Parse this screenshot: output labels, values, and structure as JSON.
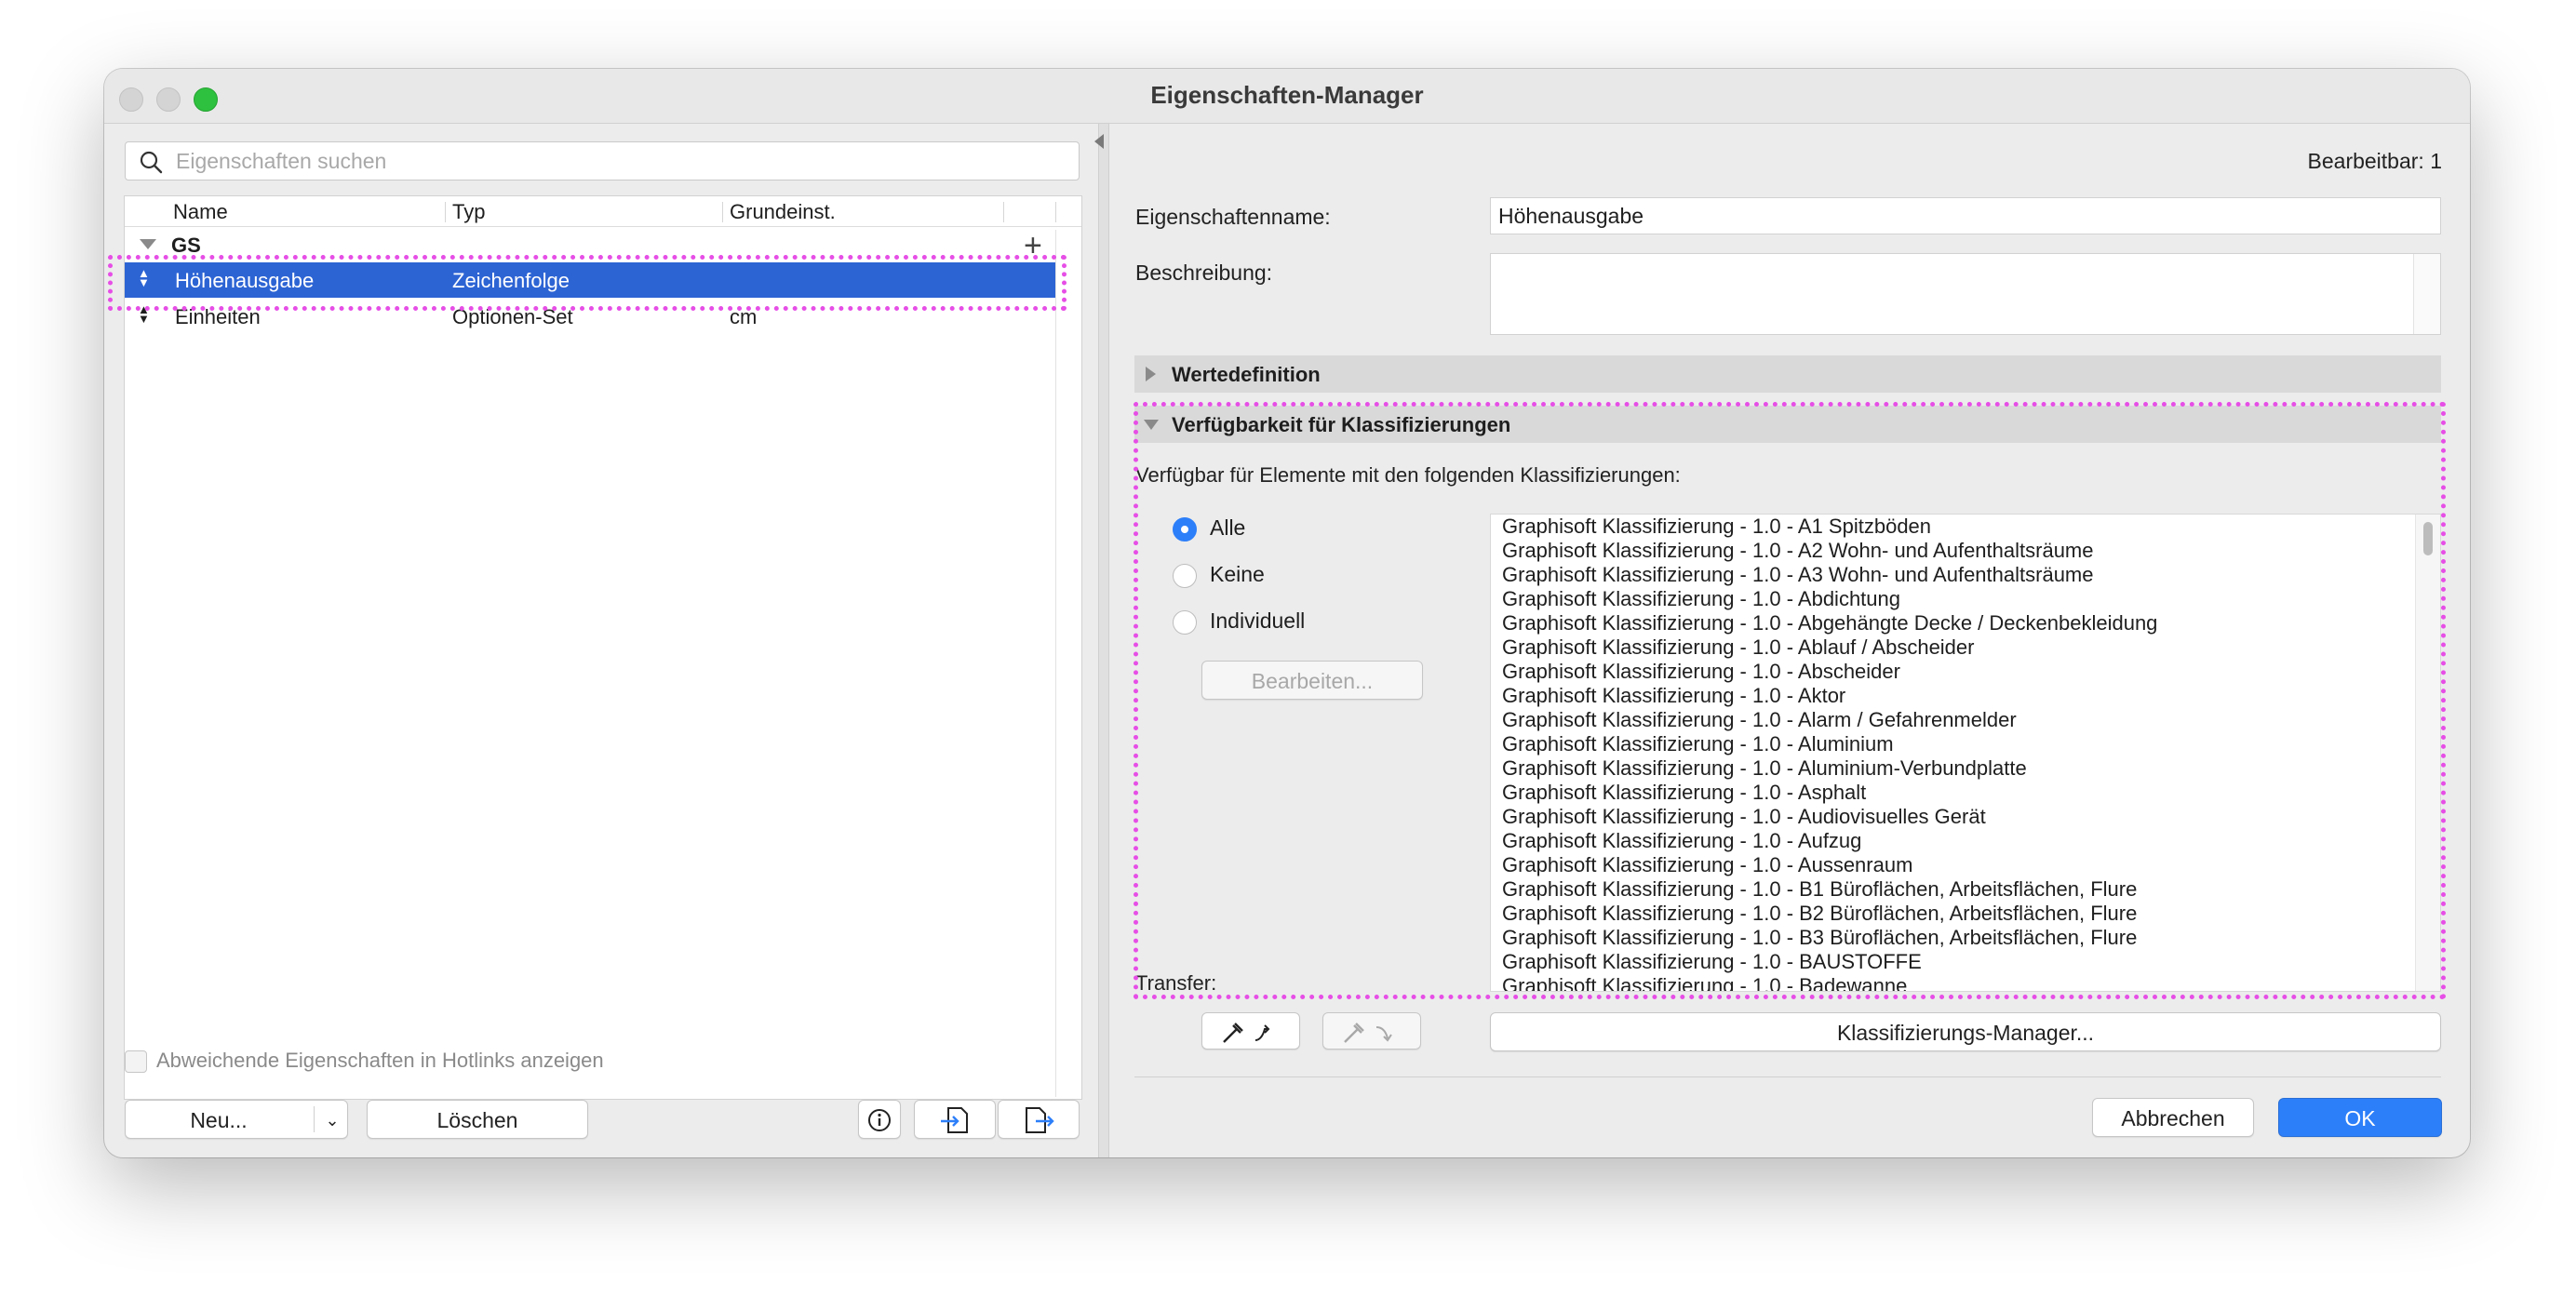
{
  "window": {
    "title": "Eigenschaften-Manager"
  },
  "search": {
    "placeholder": "Eigenschaften suchen",
    "value": ""
  },
  "table": {
    "columns": [
      "Name",
      "Typ",
      "Grundeinst."
    ],
    "group": "GS",
    "rows": [
      {
        "name": "Höhenausgabe",
        "type": "Zeichenfolge",
        "default": "",
        "selected": true
      },
      {
        "name": "Einheiten",
        "type": "Optionen-Set",
        "default": "cm",
        "selected": false
      }
    ]
  },
  "left_footer": {
    "checkbox_label": "Abweichende Eigenschaften in Hotlinks anzeigen",
    "new_label": "Neu...",
    "delete_label": "Löschen",
    "icons": [
      "info-icon",
      "import-icon",
      "export-icon"
    ]
  },
  "right": {
    "editable_label": "Bearbeitbar: 1",
    "name_label": "Eigenschaftenname:",
    "name_value": "Höhenausgabe",
    "description_label": "Beschreibung:",
    "description_value": "",
    "section_values": "Wertedefinition",
    "section_availability": "Verfügbarkeit für Klassifizierungen",
    "availability_text": "Verfügbar für Elemente mit den folgenden Klassifizierungen:",
    "radios": [
      {
        "label": "Alle",
        "checked": true
      },
      {
        "label": "Keine",
        "checked": false
      },
      {
        "label": "Individuell",
        "checked": false
      }
    ],
    "edit_button": "Bearbeiten...",
    "transfer_label": "Transfer:",
    "classifications": [
      "Graphisoft Klassifizierung - 1.0 - A1 Spitzböden",
      "Graphisoft Klassifizierung - 1.0 - A2 Wohn- und Aufenthaltsräume",
      "Graphisoft Klassifizierung - 1.0 - A3 Wohn- und Aufenthaltsräume",
      "Graphisoft Klassifizierung - 1.0 - Abdichtung",
      "Graphisoft Klassifizierung - 1.0 - Abgehängte Decke / Deckenbekleidung",
      "Graphisoft Klassifizierung - 1.0 - Ablauf / Abscheider",
      "Graphisoft Klassifizierung - 1.0 - Abscheider",
      "Graphisoft Klassifizierung - 1.0 - Aktor",
      "Graphisoft Klassifizierung - 1.0 - Alarm / Gefahrenmelder",
      "Graphisoft Klassifizierung - 1.0 - Aluminium",
      "Graphisoft Klassifizierung - 1.0 - Aluminium-Verbundplatte",
      "Graphisoft Klassifizierung - 1.0 - Asphalt",
      "Graphisoft Klassifizierung - 1.0 - Audiovisuelles Gerät",
      "Graphisoft Klassifizierung - 1.0 - Aufzug",
      "Graphisoft Klassifizierung - 1.0 - Aussenraum",
      "Graphisoft Klassifizierung - 1.0 - B1 Büroflächen, Arbeitsflächen, Flure",
      "Graphisoft Klassifizierung - 1.0 - B2 Büroflächen, Arbeitsflächen, Flure",
      "Graphisoft Klassifizierung - 1.0 - B3 Büroflächen, Arbeitsflächen, Flure",
      "Graphisoft Klassifizierung - 1.0 - BAUSTOFFE",
      "Graphisoft Klassifizierung - 1.0 - Badewanne"
    ],
    "classification_manager_button": "Klassifizierungs-Manager...",
    "cancel_button": "Abbrechen",
    "ok_button": "OK"
  },
  "colors": {
    "accent": "#2d7ff9",
    "selection": "#2d64d4",
    "highlight": "#e64ee6"
  }
}
